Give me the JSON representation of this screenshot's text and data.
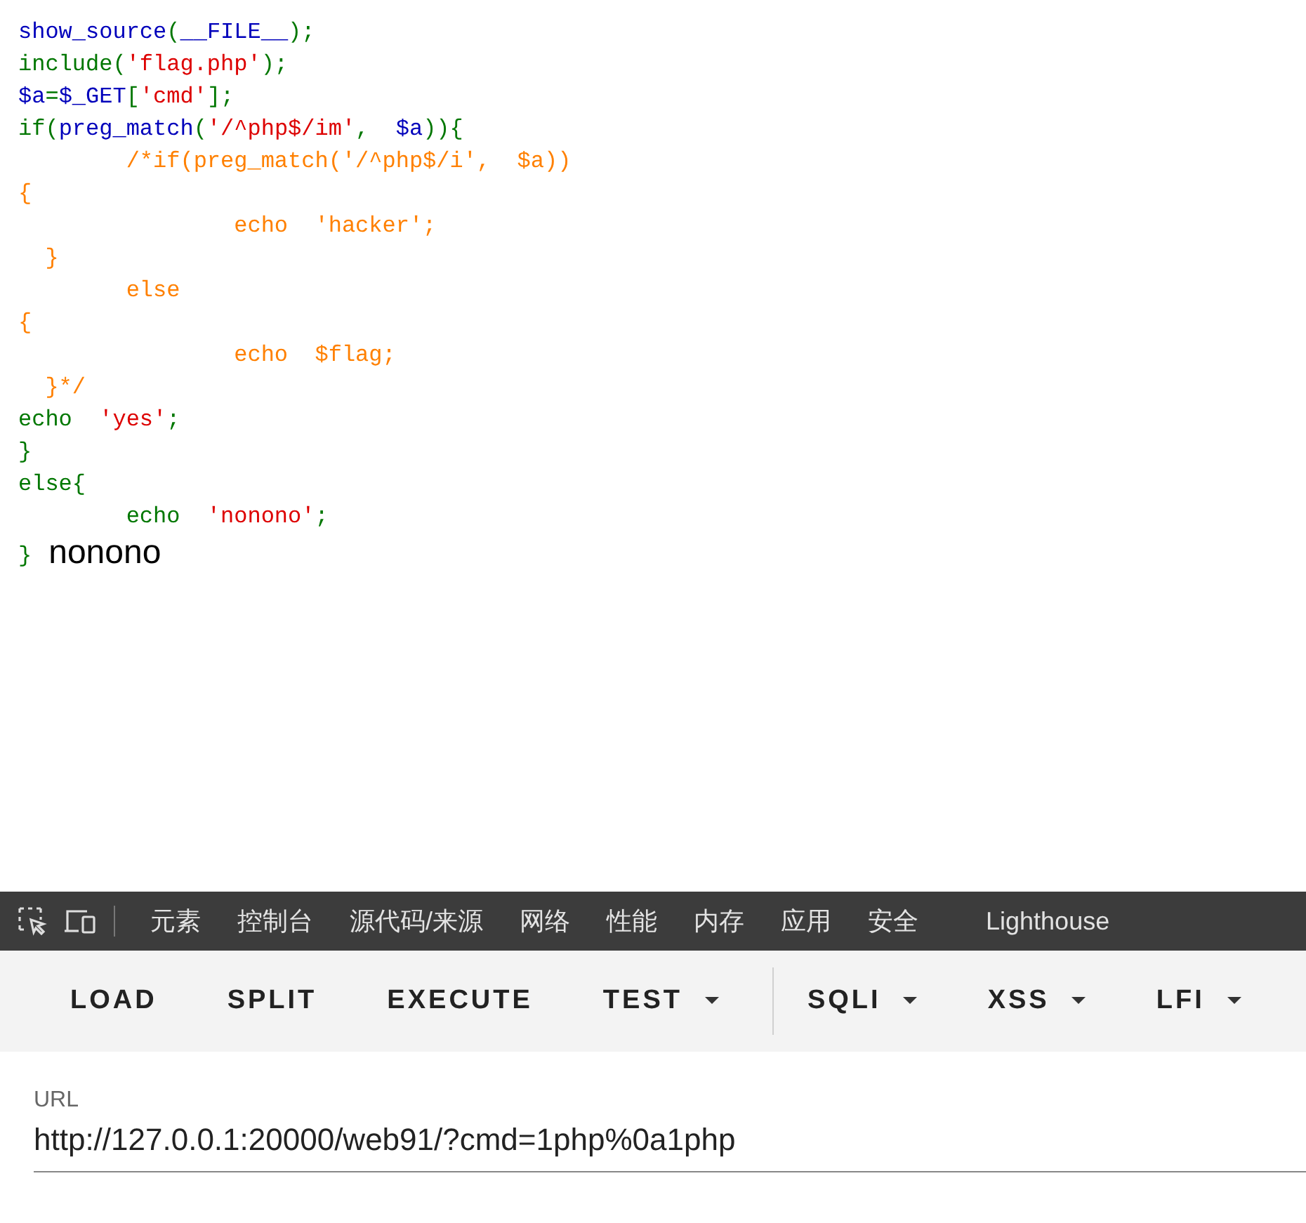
{
  "source_code": {
    "lines": [
      [
        {
          "kind": "default",
          "text": "show_source"
        },
        {
          "kind": "keyword",
          "text": "("
        },
        {
          "kind": "default",
          "text": "__FILE__"
        },
        {
          "kind": "keyword",
          "text": ");"
        }
      ],
      [
        {
          "kind": "keyword",
          "text": "include("
        },
        {
          "kind": "string",
          "text": "'flag.php'"
        },
        {
          "kind": "keyword",
          "text": ");"
        }
      ],
      [
        {
          "kind": "default",
          "text": "$a"
        },
        {
          "kind": "keyword",
          "text": "="
        },
        {
          "kind": "default",
          "text": "$_GET"
        },
        {
          "kind": "keyword",
          "text": "["
        },
        {
          "kind": "string",
          "text": "'cmd'"
        },
        {
          "kind": "keyword",
          "text": "];"
        }
      ],
      [
        {
          "kind": "keyword",
          "text": "if("
        },
        {
          "kind": "default",
          "text": "preg_match"
        },
        {
          "kind": "keyword",
          "text": "("
        },
        {
          "kind": "string",
          "text": "'/^php$/im'"
        },
        {
          "kind": "keyword",
          "text": ",  "
        },
        {
          "kind": "default",
          "text": "$a"
        },
        {
          "kind": "keyword",
          "text": ")){"
        }
      ],
      [
        {
          "kind": "comment",
          "text": "        /*if(preg_match('/^php$/i',  $a))"
        }
      ],
      [
        {
          "kind": "comment",
          "text": "{"
        }
      ],
      [
        {
          "kind": "comment",
          "text": "                echo  'hacker';"
        }
      ],
      [
        {
          "kind": "comment",
          "text": "  }"
        }
      ],
      [
        {
          "kind": "comment",
          "text": "        else"
        }
      ],
      [
        {
          "kind": "comment",
          "text": "{"
        }
      ],
      [
        {
          "kind": "comment",
          "text": "                echo  $flag;"
        }
      ],
      [
        {
          "kind": "comment",
          "text": "  }*/"
        }
      ],
      [
        {
          "kind": "keyword",
          "text": "echo  "
        },
        {
          "kind": "string",
          "text": "'yes'"
        },
        {
          "kind": "keyword",
          "text": ";"
        }
      ],
      [
        {
          "kind": "keyword",
          "text": "}"
        }
      ],
      [
        {
          "kind": "keyword",
          "text": "else{"
        }
      ],
      [
        {
          "kind": "keyword",
          "text": "        echo  "
        },
        {
          "kind": "string",
          "text": "'nonono'"
        },
        {
          "kind": "keyword",
          "text": ";"
        }
      ],
      [
        {
          "kind": "keyword",
          "text": "}"
        }
      ]
    ]
  },
  "output": "nonono",
  "devtools_tabs": [
    {
      "label": "元素"
    },
    {
      "label": "控制台"
    },
    {
      "label": "源代码/来源"
    },
    {
      "label": "网络"
    },
    {
      "label": "性能"
    },
    {
      "label": "内存"
    },
    {
      "label": "应用"
    },
    {
      "label": "安全"
    },
    {
      "label": "Lighthouse"
    }
  ],
  "hackbar_buttons": [
    {
      "label": "LOAD",
      "dropdown": false
    },
    {
      "label": "SPLIT",
      "dropdown": false
    },
    {
      "label": "EXECUTE",
      "dropdown": false
    },
    {
      "label": "TEST",
      "dropdown": true
    },
    {
      "label": "SQLI",
      "dropdown": true
    },
    {
      "label": "XSS",
      "dropdown": true
    },
    {
      "label": "LFI",
      "dropdown": true
    }
  ],
  "url_field": {
    "label": "URL",
    "value": "http://127.0.0.1:20000/web91/?cmd=1php%0a1php"
  }
}
